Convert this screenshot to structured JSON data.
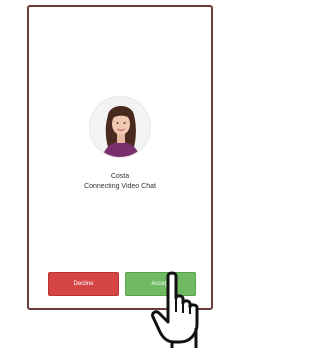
{
  "call": {
    "caller_name": "Costa",
    "status_text": "Connecting Video Chat"
  },
  "actions": {
    "decline_label": "Decline",
    "accept_label": "Accept"
  },
  "icons": {
    "pointer": "hand-pointer-icon"
  },
  "colors": {
    "frame": "#6e3a3a",
    "decline": "#d64545",
    "accept": "#6fba62"
  }
}
